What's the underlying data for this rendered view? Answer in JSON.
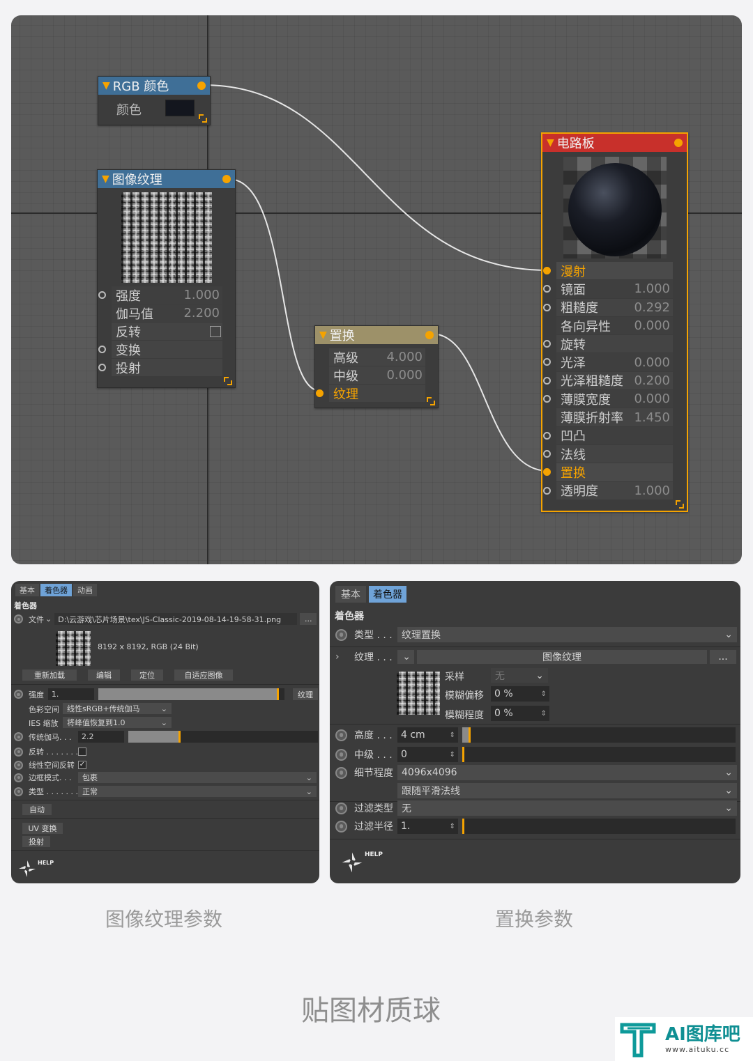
{
  "editor": {
    "rgb_node": {
      "title": "RGB 颜色",
      "row_label": "颜色",
      "color": "#13161e"
    },
    "image_node": {
      "title": "图像纹理",
      "rows": [
        {
          "label": "强度",
          "value": "1.000"
        },
        {
          "label": "伽马值",
          "value": "2.200"
        },
        {
          "label": "反转",
          "value": ""
        },
        {
          "label": "变换",
          "value": ""
        },
        {
          "label": "投射",
          "value": ""
        }
      ]
    },
    "disp_node": {
      "title": "置换",
      "rows": [
        {
          "label": "高级",
          "value": "4.000"
        },
        {
          "label": "中级",
          "value": "0.000"
        },
        {
          "label": "纹理",
          "value": ""
        }
      ]
    },
    "material_node": {
      "title": "电路板",
      "rows": [
        {
          "label": "漫射",
          "value": ""
        },
        {
          "label": "镜面",
          "value": "1.000"
        },
        {
          "label": "粗糙度",
          "value": "0.292"
        },
        {
          "label": "各向异性",
          "value": "0.000"
        },
        {
          "label": "旋转",
          "value": ""
        },
        {
          "label": "光泽",
          "value": "0.000"
        },
        {
          "label": "光泽粗糙度",
          "value": "0.200"
        },
        {
          "label": "薄膜宽度",
          "value": "0.000"
        },
        {
          "label": "薄膜折射率",
          "value": "1.450"
        },
        {
          "label": "凹凸",
          "value": ""
        },
        {
          "label": "法线",
          "value": ""
        },
        {
          "label": "置换",
          "value": ""
        },
        {
          "label": "透明度",
          "value": "1.000"
        }
      ]
    }
  },
  "left_panel": {
    "tabs": [
      "基本",
      "着色器",
      "动画"
    ],
    "section": "着色器",
    "file_label": "文件",
    "file_path": "D:\\云游戏\\芯片场景\\tex\\JS-Classic-2019-08-14-19-58-31.png",
    "file_btn": "...",
    "image_info": "8192 x 8192, RGB (24 Bit)",
    "buttons": [
      "重新加载",
      "编辑",
      "定位",
      "自适应图像"
    ],
    "strength_label": "强度",
    "strength_value": "1.",
    "strength_fill": 0.97,
    "texture_btn": "纹理",
    "colorspace_label": "色彩空间",
    "colorspace_value": "线性sRGB+传统伽马",
    "ies_label": "IES 缩放",
    "ies_value": "将峰值恢复到1.0",
    "gamma_label": "传统伽马. . .",
    "gamma_value": "2.2",
    "gamma_fill": 0.98,
    "invert_label": "反转 . . . . . . .",
    "linear_invert_label": "线性空间反转",
    "border_label": "边框模式. . .",
    "border_value": "包裹",
    "type_label": "类型 . . . . . . .",
    "type_value": "正常",
    "auto_btn": "自动",
    "uv_btn": "UV 变换",
    "proj_btn": "投射",
    "help": "HELP"
  },
  "right_panel": {
    "tabs": [
      "基本",
      "着色器"
    ],
    "section": "着色器",
    "type_label": "类型 . . .",
    "type_value": "纹理置换",
    "texture_label": "纹理 . . .",
    "texture_value": "图像纹理",
    "texture_btn": "...",
    "sample_label": "采样",
    "sample_value": "无",
    "blur_offset_label": "模糊偏移",
    "blur_offset_value": "0 %",
    "blur_level_label": "模糊程度",
    "blur_level_value": "0 %",
    "height_label": "高度 . . .",
    "height_value": "4 cm",
    "height_fill": 0.03,
    "mid_label": "中级 . . .",
    "mid_value": "0",
    "detail_label": "细节程度",
    "detail_value": "4096x4096",
    "follow_value": "跟随平滑法线",
    "filter_type_label": "过滤类型",
    "filter_type_value": "无",
    "filter_radius_label": "过滤半径",
    "filter_radius_value": "1.",
    "help": "HELP"
  },
  "captions": {
    "left": "图像纹理参数",
    "right": "置换参数",
    "main": "贴图材质球"
  },
  "watermark": {
    "name": "AI图库吧",
    "url": "www.aituku.cc"
  }
}
